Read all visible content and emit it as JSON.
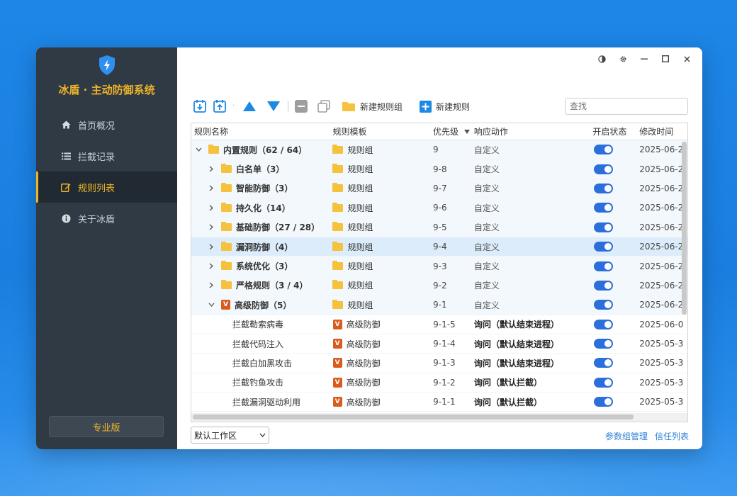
{
  "app": {
    "title": "冰盾 · 主动防御系统",
    "edition_button": "专业版"
  },
  "colors": {
    "accent": "#f0b429",
    "sidebar_bg": "#2f3a44",
    "primary_blue": "#2a6fdb",
    "folder": "#f5c23d",
    "vbadge": "#d95c1e"
  },
  "sidebar": {
    "items": [
      {
        "label": "首页概况",
        "icon": "home-icon"
      },
      {
        "label": "拦截记录",
        "icon": "list-icon"
      },
      {
        "label": "规则列表",
        "icon": "edit-icon",
        "active": true
      },
      {
        "label": "关于冰盾",
        "icon": "info-icon"
      }
    ]
  },
  "window_controls": [
    "theme-icon",
    "settings-icon",
    "minimize-icon",
    "maximize-icon",
    "close-icon"
  ],
  "toolbar": {
    "new_group_label": "新建规则组",
    "new_rule_label": "新建规则",
    "search_placeholder": "查找"
  },
  "table": {
    "headers": {
      "name": "规则名称",
      "template": "规则模板",
      "priority": "优先级",
      "action": "响应动作",
      "status": "开启状态",
      "modified": "修改时间"
    },
    "rows": [
      {
        "kind": "root",
        "name": "内置规则（62 / 64）",
        "template": "规则组",
        "priority": "9",
        "action": "自定义",
        "enabled": true,
        "modified": "2025-06-2"
      },
      {
        "kind": "group",
        "name": "白名单（3）",
        "template": "规则组",
        "priority": "9-8",
        "action": "自定义",
        "enabled": true,
        "modified": "2025-06-2"
      },
      {
        "kind": "group",
        "name": "智能防御（3）",
        "template": "规则组",
        "priority": "9-7",
        "action": "自定义",
        "enabled": true,
        "modified": "2025-06-2"
      },
      {
        "kind": "group",
        "name": "持久化（14）",
        "template": "规则组",
        "priority": "9-6",
        "action": "自定义",
        "enabled": true,
        "modified": "2025-06-2"
      },
      {
        "kind": "group",
        "name": "基础防御（27 / 28）",
        "template": "规则组",
        "priority": "9-5",
        "action": "自定义",
        "enabled": true,
        "modified": "2025-06-2"
      },
      {
        "kind": "group",
        "name": "漏洞防御（4）",
        "template": "规则组",
        "priority": "9-4",
        "action": "自定义",
        "enabled": true,
        "modified": "2025-06-2",
        "selected": true
      },
      {
        "kind": "group",
        "name": "系统优化（3）",
        "template": "规则组",
        "priority": "9-3",
        "action": "自定义",
        "enabled": true,
        "modified": "2025-06-2"
      },
      {
        "kind": "group",
        "name": "严格规则（3 / 4）",
        "template": "规则组",
        "priority": "9-2",
        "action": "自定义",
        "enabled": true,
        "modified": "2025-06-2"
      },
      {
        "kind": "vgroup",
        "name": "高级防御（5）",
        "template": "规则组",
        "priority": "9-1",
        "action": "自定义",
        "enabled": true,
        "modified": "2025-06-2"
      },
      {
        "kind": "leaf",
        "name": "拦截勒索病毒",
        "template": "高级防御",
        "priority": "9-1-5",
        "action": "询问（默认结束进程）",
        "enabled": true,
        "modified": "2025-06-0"
      },
      {
        "kind": "leaf",
        "name": "拦截代码注入",
        "template": "高级防御",
        "priority": "9-1-4",
        "action": "询问（默认结束进程）",
        "enabled": true,
        "modified": "2025-05-3"
      },
      {
        "kind": "leaf",
        "name": "拦截白加黑攻击",
        "template": "高级防御",
        "priority": "9-1-3",
        "action": "询问（默认结束进程）",
        "enabled": true,
        "modified": "2025-05-3"
      },
      {
        "kind": "leaf",
        "name": "拦截钓鱼攻击",
        "template": "高级防御",
        "priority": "9-1-2",
        "action": "询问（默认拦截）",
        "enabled": true,
        "modified": "2025-05-3"
      },
      {
        "kind": "leaf",
        "name": "拦截漏洞驱动利用",
        "template": "高级防御",
        "priority": "9-1-1",
        "action": "询问（默认拦截）",
        "enabled": true,
        "modified": "2025-05-3"
      }
    ]
  },
  "bottom": {
    "workspace_value": "默认工作区",
    "link_params": "参数组管理",
    "link_trust": "信任列表"
  }
}
